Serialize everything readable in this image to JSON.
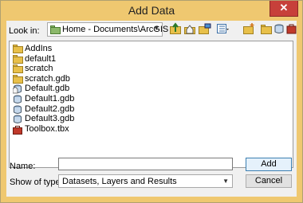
{
  "window": {
    "title": "Add Data",
    "close_glyph": "✕"
  },
  "look_in": {
    "label": "Look in:",
    "value": "Home - Documents\\ArcGIS"
  },
  "toolbar": {
    "icons": [
      "up-level-icon",
      "home-icon",
      "connect-folder-icon",
      "view-options-icon",
      "new-folder-icon",
      "folder-icon",
      "refresh-icon",
      "toolbox-icon"
    ]
  },
  "files": [
    {
      "name": "AddIns",
      "type": "folder"
    },
    {
      "name": "default1",
      "type": "folder"
    },
    {
      "name": "scratch",
      "type": "folder"
    },
    {
      "name": "scratch.gdb",
      "type": "folder"
    },
    {
      "name": "Default.gdb",
      "type": "gdb-home"
    },
    {
      "name": "Default1.gdb",
      "type": "gdb"
    },
    {
      "name": "Default2.gdb",
      "type": "gdb"
    },
    {
      "name": "Default3.gdb",
      "type": "gdb"
    },
    {
      "name": "Toolbox.tbx",
      "type": "toolbox"
    }
  ],
  "name_field": {
    "label": "Name:",
    "value": ""
  },
  "type_field": {
    "label": "Show of type:",
    "value": "Datasets, Layers and Results"
  },
  "buttons": {
    "add": "Add",
    "cancel": "Cancel"
  },
  "colors": {
    "frame": "#efc870",
    "close": "#c7403a",
    "folder": "#e8c04a",
    "accent": "#3c7fb1"
  }
}
